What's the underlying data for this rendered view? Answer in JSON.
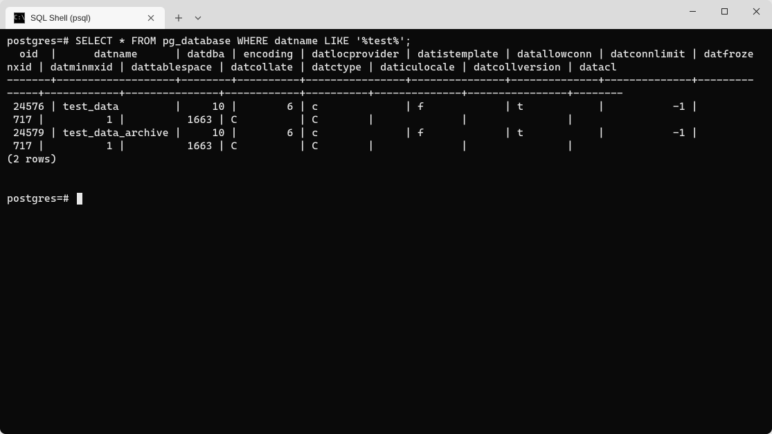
{
  "window": {
    "tab_title": "SQL Shell (psql)",
    "tab_icon_text": "C:\\"
  },
  "terminal": {
    "prompt": "postgres=#",
    "query": "SELECT * FROM pg_database WHERE datname LIKE '%test%';",
    "header_line1": "  oid  |      datname      | datdba | encoding | datlocprovider | datistemplate | datallowconn | datconnlimit | datfroze",
    "header_line2": "nxid | datminmxid | dattablespace | datcollate | datctype | daticulocale | datcollversion | datacl",
    "separator_line1": "-------+-------------------+--------+----------+----------------+---------------+--------------+--------------+---------",
    "separator_line2": "-----+------------+---------------+------------+----------+--------------+----------------+--------",
    "row1_line1": " 24576 | test_data         |     10 |        6 | c              | f             | t            |           -1 |",
    "row1_line2": " 717 |          1 |          1663 | C          | C        |              |                |",
    "row2_line1": " 24579 | test_data_archive |     10 |        6 | c              | f             | t            |           -1 |",
    "row2_line2": " 717 |          1 |          1663 | C          | C        |              |                |",
    "row_count": "(2 rows)",
    "prompt2": "postgres=#"
  },
  "query_result": {
    "columns": [
      "oid",
      "datname",
      "datdba",
      "encoding",
      "datlocprovider",
      "datistemplate",
      "datallowconn",
      "datconnlimit",
      "datfrozenxid",
      "datminmxid",
      "dattablespace",
      "datcollate",
      "datctype",
      "daticulocale",
      "datcollversion",
      "datacl"
    ],
    "rows": [
      {
        "oid": 24576,
        "datname": "test_data",
        "datdba": 10,
        "encoding": 6,
        "datlocprovider": "c",
        "datistemplate": "f",
        "datallowconn": "t",
        "datconnlimit": -1,
        "datfrozenxid": 717,
        "datminmxid": 1,
        "dattablespace": 1663,
        "datcollate": "C",
        "datctype": "C",
        "daticulocale": "",
        "datcollversion": "",
        "datacl": ""
      },
      {
        "oid": 24579,
        "datname": "test_data_archive",
        "datdba": 10,
        "encoding": 6,
        "datlocprovider": "c",
        "datistemplate": "f",
        "datallowconn": "t",
        "datconnlimit": -1,
        "datfrozenxid": 717,
        "datminmxid": 1,
        "dattablespace": 1663,
        "datcollate": "C",
        "datctype": "C",
        "daticulocale": "",
        "datcollversion": "",
        "datacl": ""
      }
    ],
    "row_count_value": 2
  }
}
